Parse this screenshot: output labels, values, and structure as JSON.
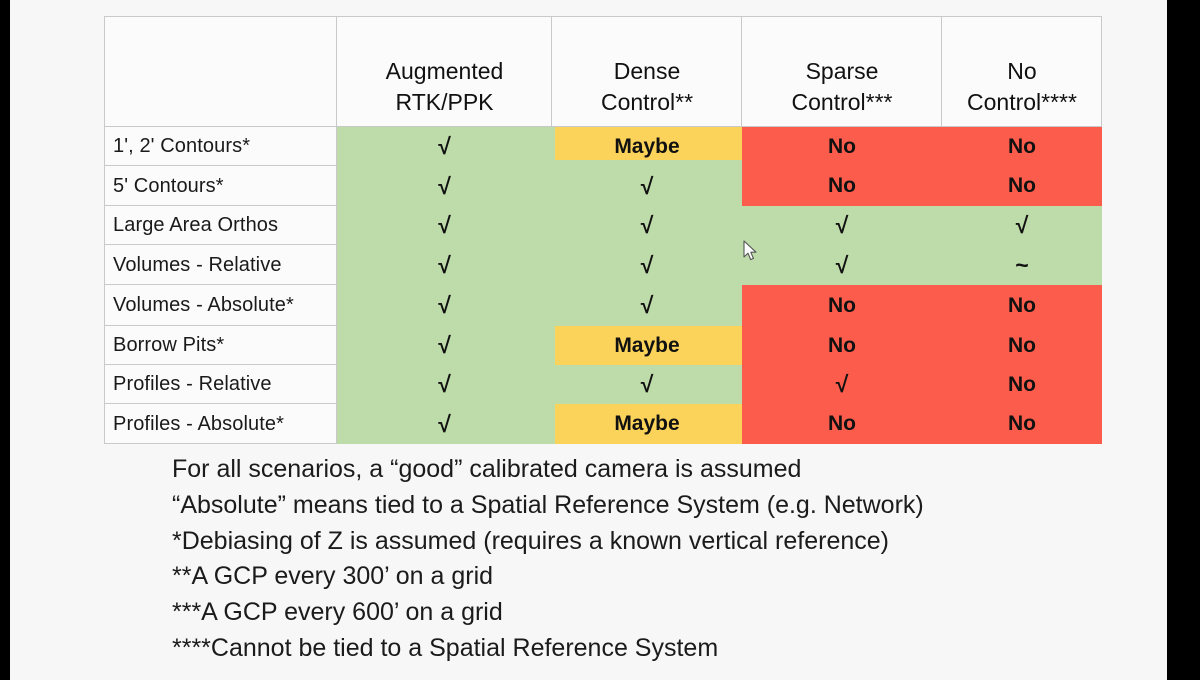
{
  "table": {
    "corner_label": "",
    "columns": [
      {
        "line1": "Augmented",
        "line2": "RTK/PPK"
      },
      {
        "line1": "Dense",
        "line2": "Control**"
      },
      {
        "line1": "Sparse",
        "line2": "Control***"
      },
      {
        "line1": "No",
        "line2": "Control****"
      }
    ],
    "rows": [
      {
        "label": "1', 2' Contours*",
        "cells": [
          "√",
          "Maybe",
          "No",
          "No"
        ]
      },
      {
        "label": "5' Contours*",
        "cells": [
          "√",
          "√",
          "No",
          "No"
        ]
      },
      {
        "label": "Large Area Orthos",
        "cells": [
          "√",
          "√",
          "√",
          "√"
        ]
      },
      {
        "label": "Volumes - Relative",
        "cells": [
          "√",
          "√",
          "√",
          "~"
        ]
      },
      {
        "label": "Volumes - Absolute*",
        "cells": [
          "√",
          "√",
          "No",
          "No"
        ]
      },
      {
        "label": "Borrow Pits*",
        "cells": [
          "√",
          "Maybe",
          "No",
          "No"
        ]
      },
      {
        "label": "Profiles - Relative",
        "cells": [
          "√",
          "√",
          "√",
          "No"
        ]
      },
      {
        "label": "Profiles - Absolute*",
        "cells": [
          "√",
          "Maybe",
          "No",
          "No"
        ]
      }
    ]
  },
  "legend_colors": {
    "green": "#bedca9",
    "yellow": "#fbd25a",
    "red": "#fc5c4b",
    "header_bg": "#fbfbfb",
    "grid_line": "#c9c9c9",
    "page_bg": "#f7f7f7"
  },
  "notes": [
    "For all scenarios, a “good” calibrated camera is assumed",
    "“Absolute” means tied to a Spatial Reference System (e.g. Network)",
    "*Debiasing of Z is assumed (requires a known vertical reference)",
    "**A GCP every 300’ on a grid",
    "***A GCP every 600’ on a grid",
    "****Cannot be tied to a Spatial Reference System"
  ]
}
